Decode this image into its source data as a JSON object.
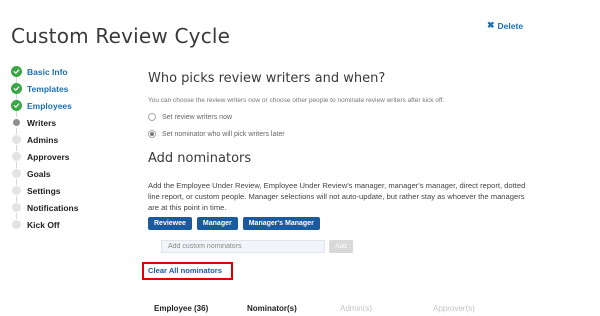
{
  "page": {
    "title": "Custom Review Cycle",
    "delete_label": "Delete"
  },
  "colors": {
    "link": "#1a6fb5",
    "done": "#3aa645",
    "chip": "#1a5a9e",
    "highlight": "#e00000"
  },
  "stepper": {
    "items": [
      {
        "label": "Basic Info",
        "state": "done"
      },
      {
        "label": "Templates",
        "state": "done"
      },
      {
        "label": "Employees",
        "state": "done"
      },
      {
        "label": "Writers",
        "state": "current"
      },
      {
        "label": "Admins",
        "state": "pending"
      },
      {
        "label": "Approvers",
        "state": "pending"
      },
      {
        "label": "Goals",
        "state": "pending"
      },
      {
        "label": "Settings",
        "state": "pending"
      },
      {
        "label": "Notifications",
        "state": "pending"
      },
      {
        "label": "Kick Off",
        "state": "pending"
      }
    ]
  },
  "writers": {
    "heading": "Who picks review writers and when?",
    "helper": "You can choose the review writers now or choose other people to nominate review writers after kick off.",
    "options": [
      {
        "label": "Set review writers now",
        "checked": false
      },
      {
        "label": "Set nominator who will pick writers later",
        "checked": true
      }
    ]
  },
  "nominators": {
    "heading": "Add nominators",
    "description": "Add the Employee Under Review, Employee Under Review's manager, manager's manager, direct report, dotted line report, or custom people. Manager selections will not auto-update, but rather stay as whoever the managers are at this point in time.",
    "chips": [
      "Reviewee",
      "Manager",
      "Manager's Manager"
    ],
    "input_placeholder": "Add custom nominators",
    "add_label": "Add",
    "clear_label": "Clear All nominators"
  },
  "table": {
    "columns": [
      {
        "label": "Employee (36)",
        "active": true
      },
      {
        "label": "Nominator(s)",
        "active": true
      },
      {
        "label": "Admin(s)",
        "active": false
      },
      {
        "label": "Approver(s)",
        "active": false
      }
    ]
  }
}
